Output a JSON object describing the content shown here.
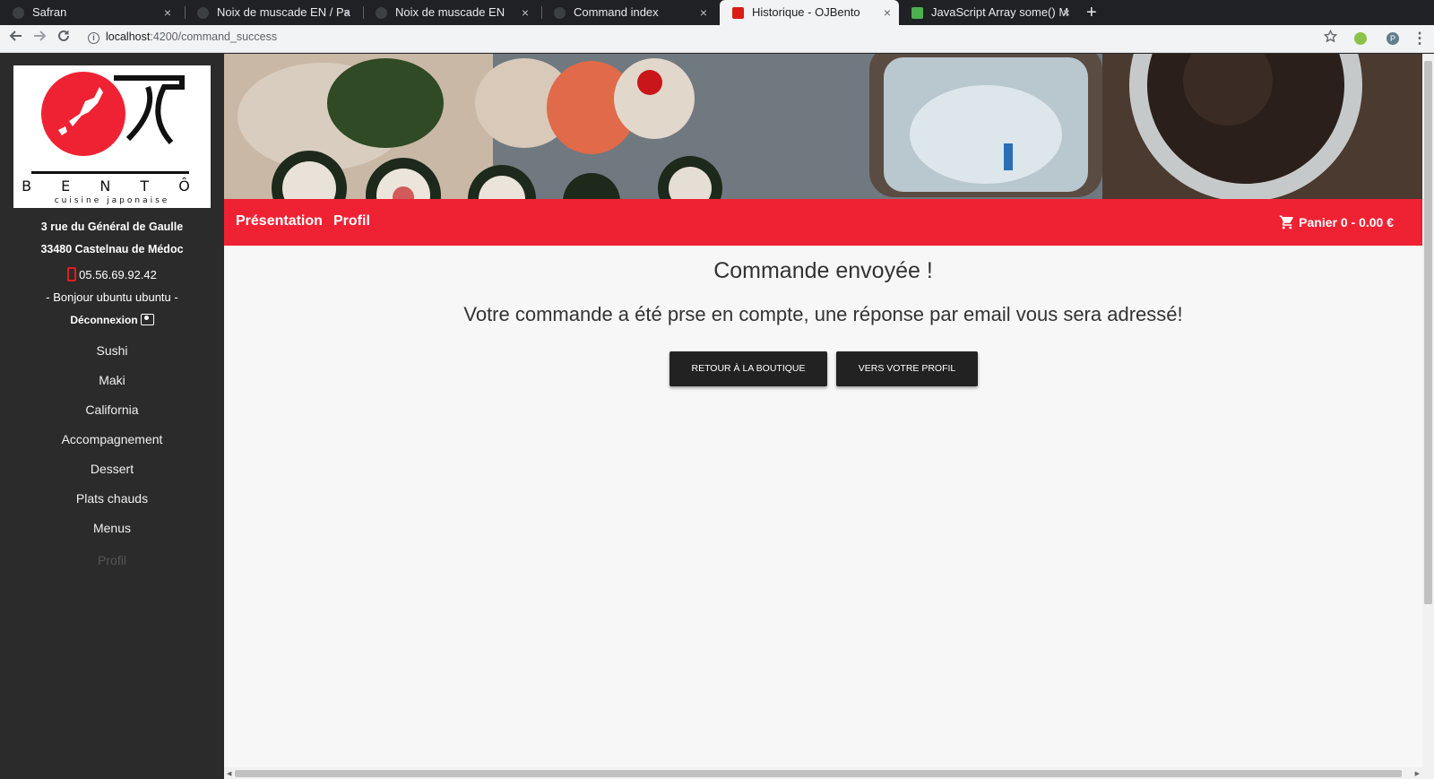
{
  "browser": {
    "tabs": [
      {
        "title": "Safran",
        "active": false
      },
      {
        "title": "Noix de muscade EN / Pa",
        "active": false
      },
      {
        "title": "Noix de muscade EN",
        "active": false
      },
      {
        "title": "Command index",
        "active": false
      },
      {
        "title": "Historique - OJBento",
        "active": true
      },
      {
        "title": "JavaScript Array some() M",
        "active": false
      }
    ],
    "tab_close": "×",
    "new_tab": "+",
    "url_host": "localhost",
    "url_path": ":4200/command_success",
    "info": "i",
    "profile_initial": "P"
  },
  "sidebar": {
    "logo": {
      "brand": "B E N T Ô",
      "tagline": "cuisine japonaise"
    },
    "address_line1": "3 rue du Général de Gaulle",
    "address_line2": "33480 Castelnau de Médoc",
    "phone": "05.56.69.92.42",
    "greeting": "- Bonjour ubuntu ubuntu -",
    "logout": "Déconnexion",
    "menu": [
      "Sushi",
      "Maki",
      "California",
      "Accompagnement",
      "Dessert",
      "Plats chauds",
      "Menus",
      "Profil"
    ]
  },
  "navbar": {
    "links": [
      "Présentation",
      "Profil"
    ],
    "cart": "Panier 0 - 0.00 €"
  },
  "content": {
    "title": "Commande envoyée !",
    "message": "Votre commande a été prse en compte, une réponse par email vous sera adressé!",
    "buttons": {
      "shop": "RETOUR À LA BOUTIQUE",
      "profile": "VERS VOTRE PROFIL"
    }
  },
  "colors": {
    "accent": "#ef2234",
    "sidebar": "#2b2b2b",
    "button": "#222222"
  }
}
